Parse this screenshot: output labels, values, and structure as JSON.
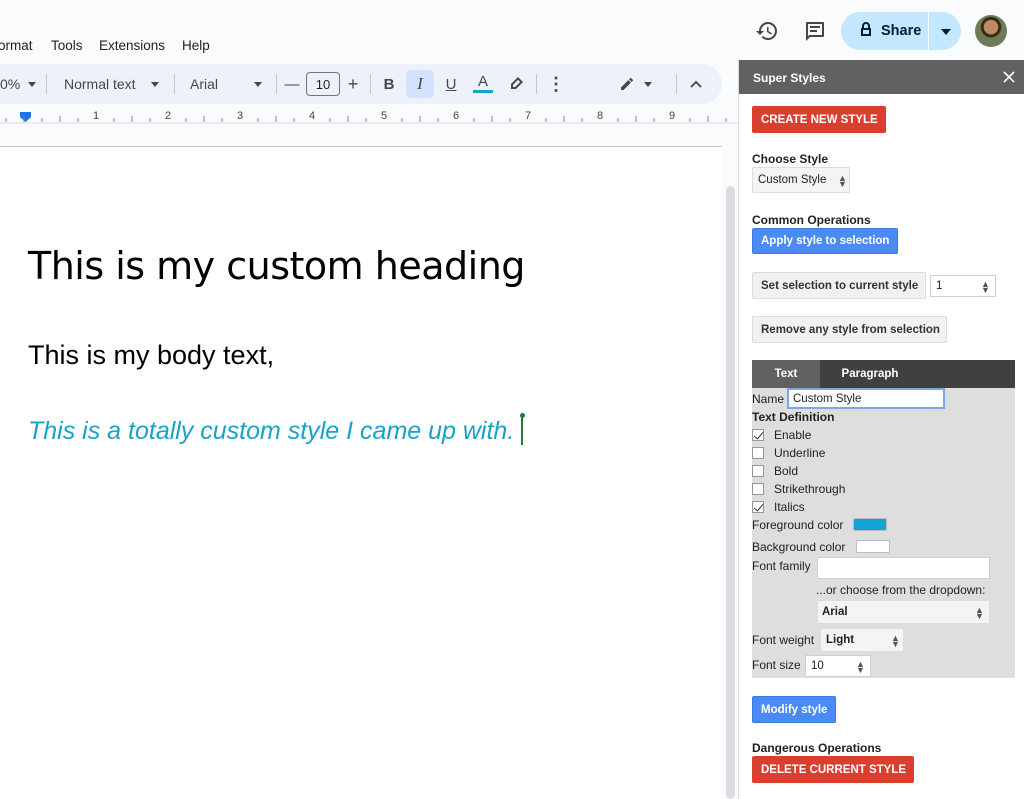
{
  "menu": {
    "items": [
      "ormat",
      "Tools",
      "Extensions",
      "Help"
    ]
  },
  "header": {
    "share_label": "Share",
    "icons": [
      "history-icon",
      "comment-icon",
      "lock-icon",
      "chevron-down-icon"
    ]
  },
  "toolbar": {
    "zoom": "0%",
    "style": "Normal text",
    "font": "Arial",
    "minus": "—",
    "font_size": "10",
    "plus": "+",
    "bold": "B",
    "italic": "I",
    "underline": "U",
    "text_color_letter": "A",
    "more": "⋮",
    "collapse": "︿",
    "text_color": "#17a2c9"
  },
  "ruler": {
    "numbers": [
      "1",
      "2",
      "3",
      "4",
      "5",
      "6",
      "7",
      "8",
      "9"
    ]
  },
  "document": {
    "heading": "This is my custom heading",
    "body": "This is my body text,",
    "custom": "This is a totally custom style I came up with."
  },
  "panel": {
    "title": "Super Styles",
    "create_button": "CREATE NEW STYLE",
    "choose_style_label": "Choose Style",
    "choose_style_value": "Custom Style",
    "common_ops_label": "Common Operations",
    "apply_button": "Apply style to selection",
    "set_selection_button": "Set selection to current style",
    "set_selection_number": "1",
    "remove_button": "Remove any style from selection",
    "tabs": {
      "text": "Text",
      "paragraph": "Paragraph"
    },
    "name_label": "Name",
    "name_value": "Custom Style",
    "text_definition_label": "Text Definition",
    "checkboxes": [
      {
        "label": "Enable",
        "checked": true
      },
      {
        "label": "Underline",
        "checked": false
      },
      {
        "label": "Bold",
        "checked": false
      },
      {
        "label": "Strikethrough",
        "checked": false
      },
      {
        "label": "Italics",
        "checked": true
      }
    ],
    "foreground_label": "Foreground color",
    "foreground_color": "#12a2d8",
    "background_label": "Background color",
    "background_color": "#ffffff",
    "font_family_label": "Font family",
    "font_family_value": "",
    "dropdown_hint": "...or choose from the dropdown:",
    "font_dropdown_value": "Arial",
    "font_weight_label": "Font weight",
    "font_weight_value": "Light",
    "font_size_label": "Font size",
    "font_size_value": "10",
    "modify_button": "Modify style",
    "dangerous_label": "Dangerous Operations",
    "delete_button": "DELETE CURRENT STYLE"
  },
  "colors": {
    "red": "#d93f2e",
    "blue": "#4a8af4",
    "panel_header": "#616161",
    "share_bg": "#c2e7ff"
  }
}
